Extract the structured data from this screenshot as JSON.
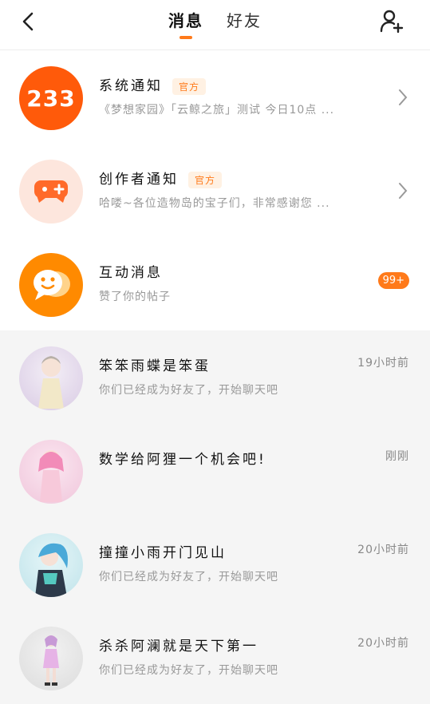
{
  "header": {
    "tabs": [
      {
        "label": "消息"
      },
      {
        "label": "好友"
      }
    ]
  },
  "notices": [
    {
      "title": "系统通知",
      "tag": "官方",
      "subtitle": "《梦想家园》「云鲸之旅」测试 今日10点 ...",
      "logo_text": "233"
    },
    {
      "title": "创作者通知",
      "tag": "官方",
      "subtitle": "哈喽~各位造物岛的宝子们，非常感谢您 ..."
    },
    {
      "title": "互动消息",
      "subtitle": "赞了你的帖子",
      "badge": "99+"
    }
  ],
  "chats": [
    {
      "name": "笨笨雨蝶是笨蛋",
      "message": "你们已经成为好友了，开始聊天吧",
      "time": "19小时前",
      "avatar_color": "#e9dff0"
    },
    {
      "name": "数学给阿狸一个机会吧!",
      "message": "",
      "time": "刚刚",
      "avatar_color": "#f5d9e8"
    },
    {
      "name": "撞撞小雨开门见山",
      "message": "你们已经成为好友了，开始聊天吧",
      "time": "20小时前",
      "avatar_color": "#d9eef2"
    },
    {
      "name": "杀杀阿澜就是天下第一",
      "message": "你们已经成为好友了，开始聊天吧",
      "time": "20小时前",
      "avatar_color": "#e6e6e6"
    }
  ],
  "colors": {
    "accent": "#ff7a1a"
  }
}
